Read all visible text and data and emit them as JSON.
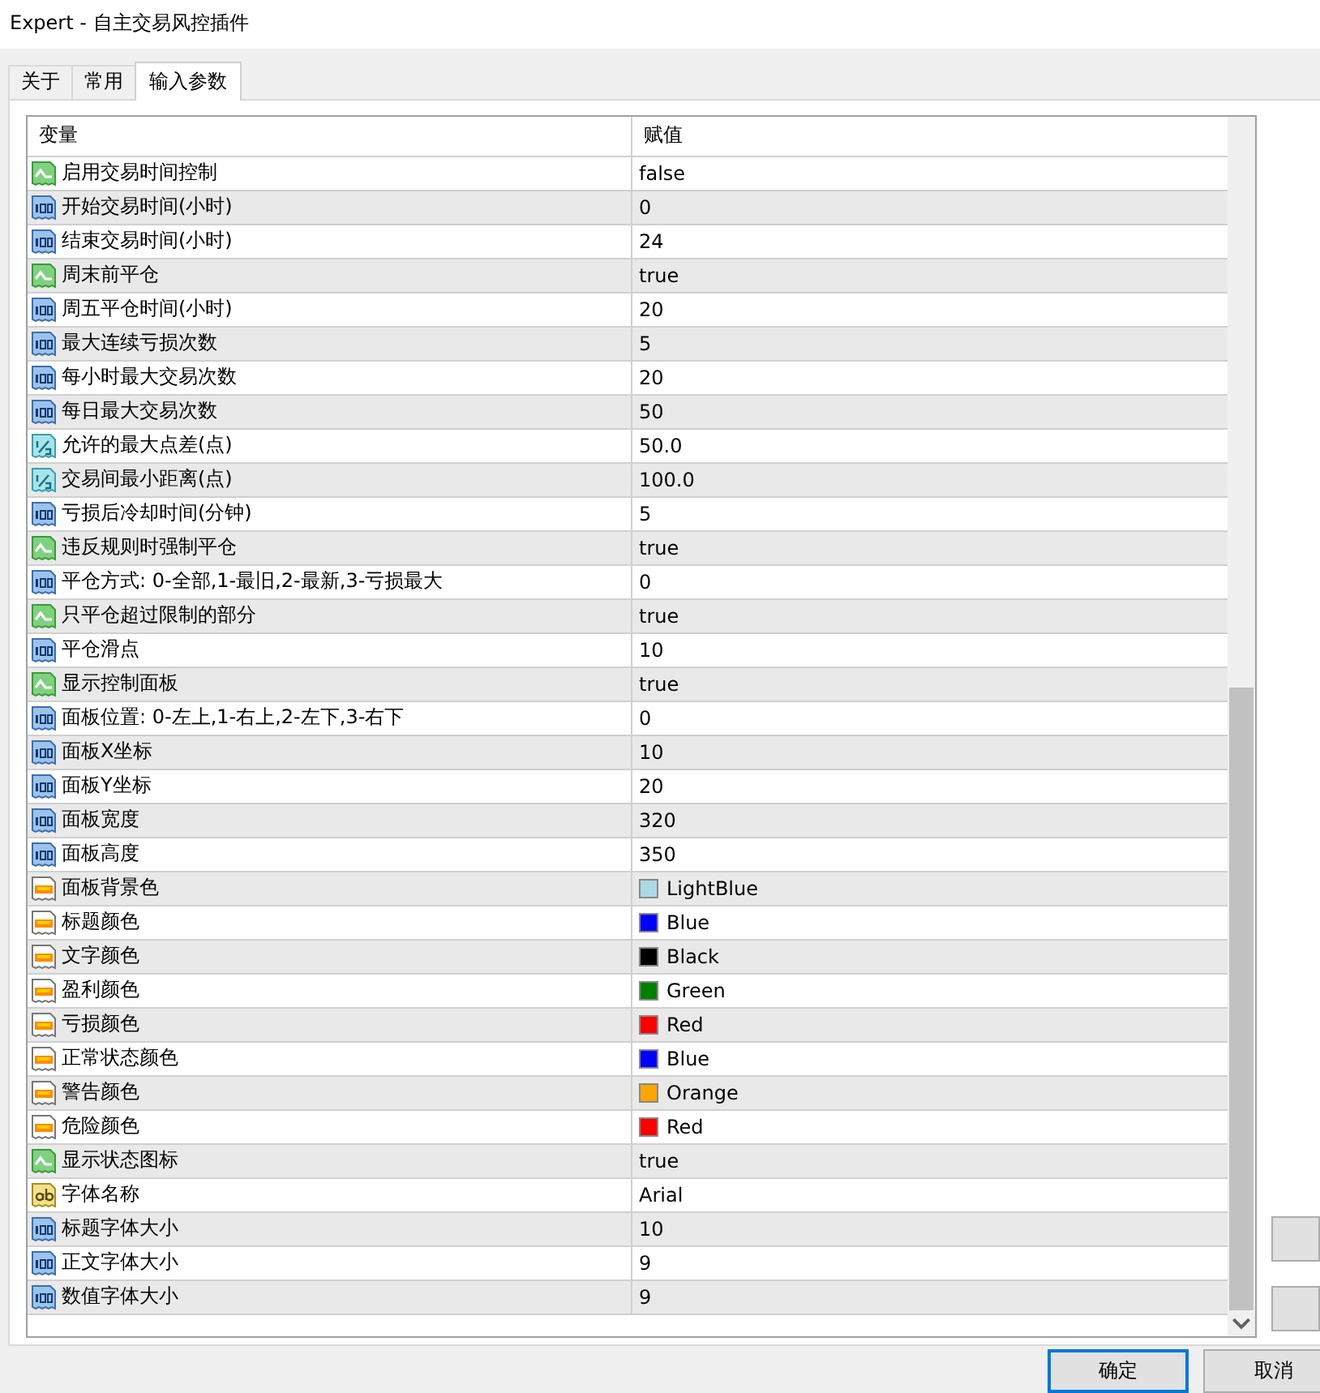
{
  "window": {
    "title": "Expert - 自主交易风控插件"
  },
  "tabs": [
    {
      "label": "关于",
      "selected": false
    },
    {
      "label": "常用",
      "selected": false
    },
    {
      "label": "输入参数",
      "selected": true
    }
  ],
  "table": {
    "columns": [
      "变量",
      "赋值"
    ],
    "rows": [
      {
        "kind": "bool",
        "name": "启用交易时间控制",
        "value": "false"
      },
      {
        "kind": "int",
        "name": "开始交易时间(小时)",
        "value": "0"
      },
      {
        "kind": "int",
        "name": "结束交易时间(小时)",
        "value": "24"
      },
      {
        "kind": "bool",
        "name": "周末前平仓",
        "value": "true"
      },
      {
        "kind": "int",
        "name": "周五平仓时间(小时)",
        "value": "20"
      },
      {
        "kind": "int",
        "name": "最大连续亏损次数",
        "value": "5"
      },
      {
        "kind": "int",
        "name": "每小时最大交易次数",
        "value": "20"
      },
      {
        "kind": "int",
        "name": "每日最大交易次数",
        "value": "50"
      },
      {
        "kind": "double",
        "name": "允许的最大点差(点)",
        "value": "50.0"
      },
      {
        "kind": "double",
        "name": "交易间最小距离(点)",
        "value": "100.0"
      },
      {
        "kind": "int",
        "name": "亏损后冷却时间(分钟)",
        "value": "5"
      },
      {
        "kind": "bool",
        "name": "违反规则时强制平仓",
        "value": "true"
      },
      {
        "kind": "int",
        "name": "平仓方式: 0-全部,1-最旧,2-最新,3-亏损最大",
        "value": "0"
      },
      {
        "kind": "bool",
        "name": "只平仓超过限制的部分",
        "value": "true"
      },
      {
        "kind": "int",
        "name": "平仓滑点",
        "value": "10"
      },
      {
        "kind": "bool",
        "name": "显示控制面板",
        "value": "true"
      },
      {
        "kind": "int",
        "name": "面板位置: 0-左上,1-右上,2-左下,3-右下",
        "value": "0"
      },
      {
        "kind": "int",
        "name": "面板X坐标",
        "value": "10"
      },
      {
        "kind": "int",
        "name": "面板Y坐标",
        "value": "20"
      },
      {
        "kind": "int",
        "name": "面板宽度",
        "value": "320"
      },
      {
        "kind": "int",
        "name": "面板高度",
        "value": "350"
      },
      {
        "kind": "color",
        "name": "面板背景色",
        "value": "LightBlue",
        "color": "#add8e6"
      },
      {
        "kind": "color",
        "name": "标题颜色",
        "value": "Blue",
        "color": "#0000ff"
      },
      {
        "kind": "color",
        "name": "文字颜色",
        "value": "Black",
        "color": "#000000"
      },
      {
        "kind": "color",
        "name": "盈利颜色",
        "value": "Green",
        "color": "#008000"
      },
      {
        "kind": "color",
        "name": "亏损颜色",
        "value": "Red",
        "color": "#ff0000"
      },
      {
        "kind": "color",
        "name": "正常状态颜色",
        "value": "Blue",
        "color": "#0000ff"
      },
      {
        "kind": "color",
        "name": "警告颜色",
        "value": "Orange",
        "color": "#ffa500"
      },
      {
        "kind": "color",
        "name": "危险颜色",
        "value": "Red",
        "color": "#ff0000"
      },
      {
        "kind": "bool",
        "name": "显示状态图标",
        "value": "true"
      },
      {
        "kind": "string",
        "name": "字体名称",
        "value": "Arial"
      },
      {
        "kind": "int",
        "name": "标题字体大小",
        "value": "10"
      },
      {
        "kind": "int",
        "name": "正文字体大小",
        "value": "9"
      },
      {
        "kind": "int",
        "name": "数值字体大小",
        "value": "9"
      }
    ]
  },
  "buttons": [
    {
      "label": "确定",
      "selected": true
    },
    {
      "label": "取消",
      "selected": false
    }
  ]
}
